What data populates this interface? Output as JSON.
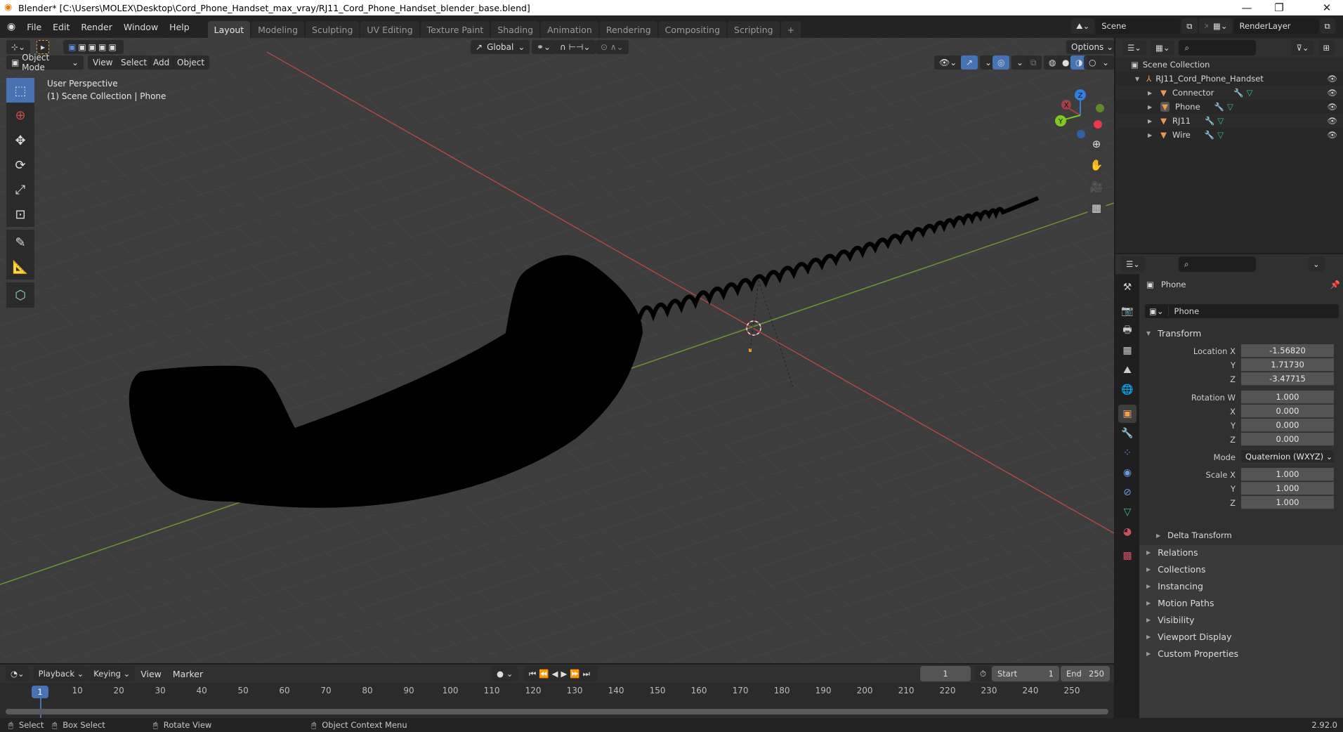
{
  "window": {
    "title": "Blender* [C:\\Users\\MOLEX\\Desktop\\Cord_Phone_Handset_max_vray/RJ11_Cord_Phone_Handset_blender_base.blend]",
    "minimize": "—",
    "maximize": "❐",
    "close": "✕"
  },
  "menubar": {
    "items": [
      "File",
      "Edit",
      "Render",
      "Window",
      "Help"
    ]
  },
  "workspaces": {
    "tabs": [
      "Layout",
      "Modeling",
      "Sculpting",
      "UV Editing",
      "Texture Paint",
      "Shading",
      "Animation",
      "Rendering",
      "Compositing",
      "Scripting"
    ],
    "active": "Layout",
    "add": "+"
  },
  "scene": {
    "name": "Scene",
    "view_layer": "RenderLayer"
  },
  "tool_header": {
    "orientation": "Global",
    "options": "Options"
  },
  "view_header": {
    "mode": "Object Mode",
    "menus": [
      "View",
      "Select",
      "Add",
      "Object"
    ]
  },
  "viewport": {
    "perspective": "User Perspective",
    "context": "(1) Scene Collection | Phone",
    "gizmo": {
      "x": "X",
      "y": "Y",
      "z": "Z"
    },
    "colors": {
      "x_axis": "#c94c4c",
      "y_axis": "#7ba23b",
      "z_axis": "#2f80e0",
      "grid_bg": "#3d3d3d"
    }
  },
  "tools": [
    "select-box",
    "cursor",
    "move",
    "rotate",
    "scale",
    "transform",
    "annotate",
    "measure",
    "add-cube"
  ],
  "outliner": {
    "root": "Scene Collection",
    "collection": "RJ11_Cord_Phone_Handset",
    "objects": [
      {
        "name": "Connector",
        "selected": false
      },
      {
        "name": "Phone",
        "selected": true
      },
      {
        "name": "RJ11",
        "selected": false
      },
      {
        "name": "Wire",
        "selected": false
      }
    ]
  },
  "properties": {
    "object_name": "Phone",
    "datablock_name": "Phone",
    "transform": {
      "title": "Transform",
      "location": {
        "label": "Location X",
        "x": "-1.56820",
        "y": "1.71730",
        "z": "-3.47715"
      },
      "rotation": {
        "label": "Rotation W",
        "w": "1.000",
        "x": "0.000",
        "y": "0.000",
        "z": "0.000"
      },
      "mode_label": "Mode",
      "mode": "Quaternion (WXYZ)",
      "scale": {
        "label": "Scale X",
        "x": "1.000",
        "y": "1.000",
        "z": "1.000"
      },
      "axis_labels": {
        "x": "X",
        "y": "Y",
        "z": "Z"
      }
    },
    "subpanel": "Delta Transform",
    "panels": [
      "Relations",
      "Collections",
      "Instancing",
      "Motion Paths",
      "Visibility",
      "Viewport Display",
      "Custom Properties"
    ]
  },
  "timeline": {
    "menus": [
      "Playback",
      "Keying",
      "View",
      "Marker"
    ],
    "current_frame": "1",
    "start_label": "Start",
    "start": "1",
    "end_label": "End",
    "end": "250",
    "ticks": [
      "10",
      "20",
      "30",
      "40",
      "50",
      "60",
      "70",
      "80",
      "90",
      "100",
      "110",
      "120",
      "130",
      "140",
      "150",
      "160",
      "170",
      "180",
      "190",
      "200",
      "210",
      "220",
      "230",
      "240",
      "250"
    ],
    "playhead": "1"
  },
  "statusbar": {
    "select": "Select",
    "box_select": "Box Select",
    "rotate_view": "Rotate View",
    "context_menu": "Object Context Menu",
    "version": "2.92.0"
  }
}
